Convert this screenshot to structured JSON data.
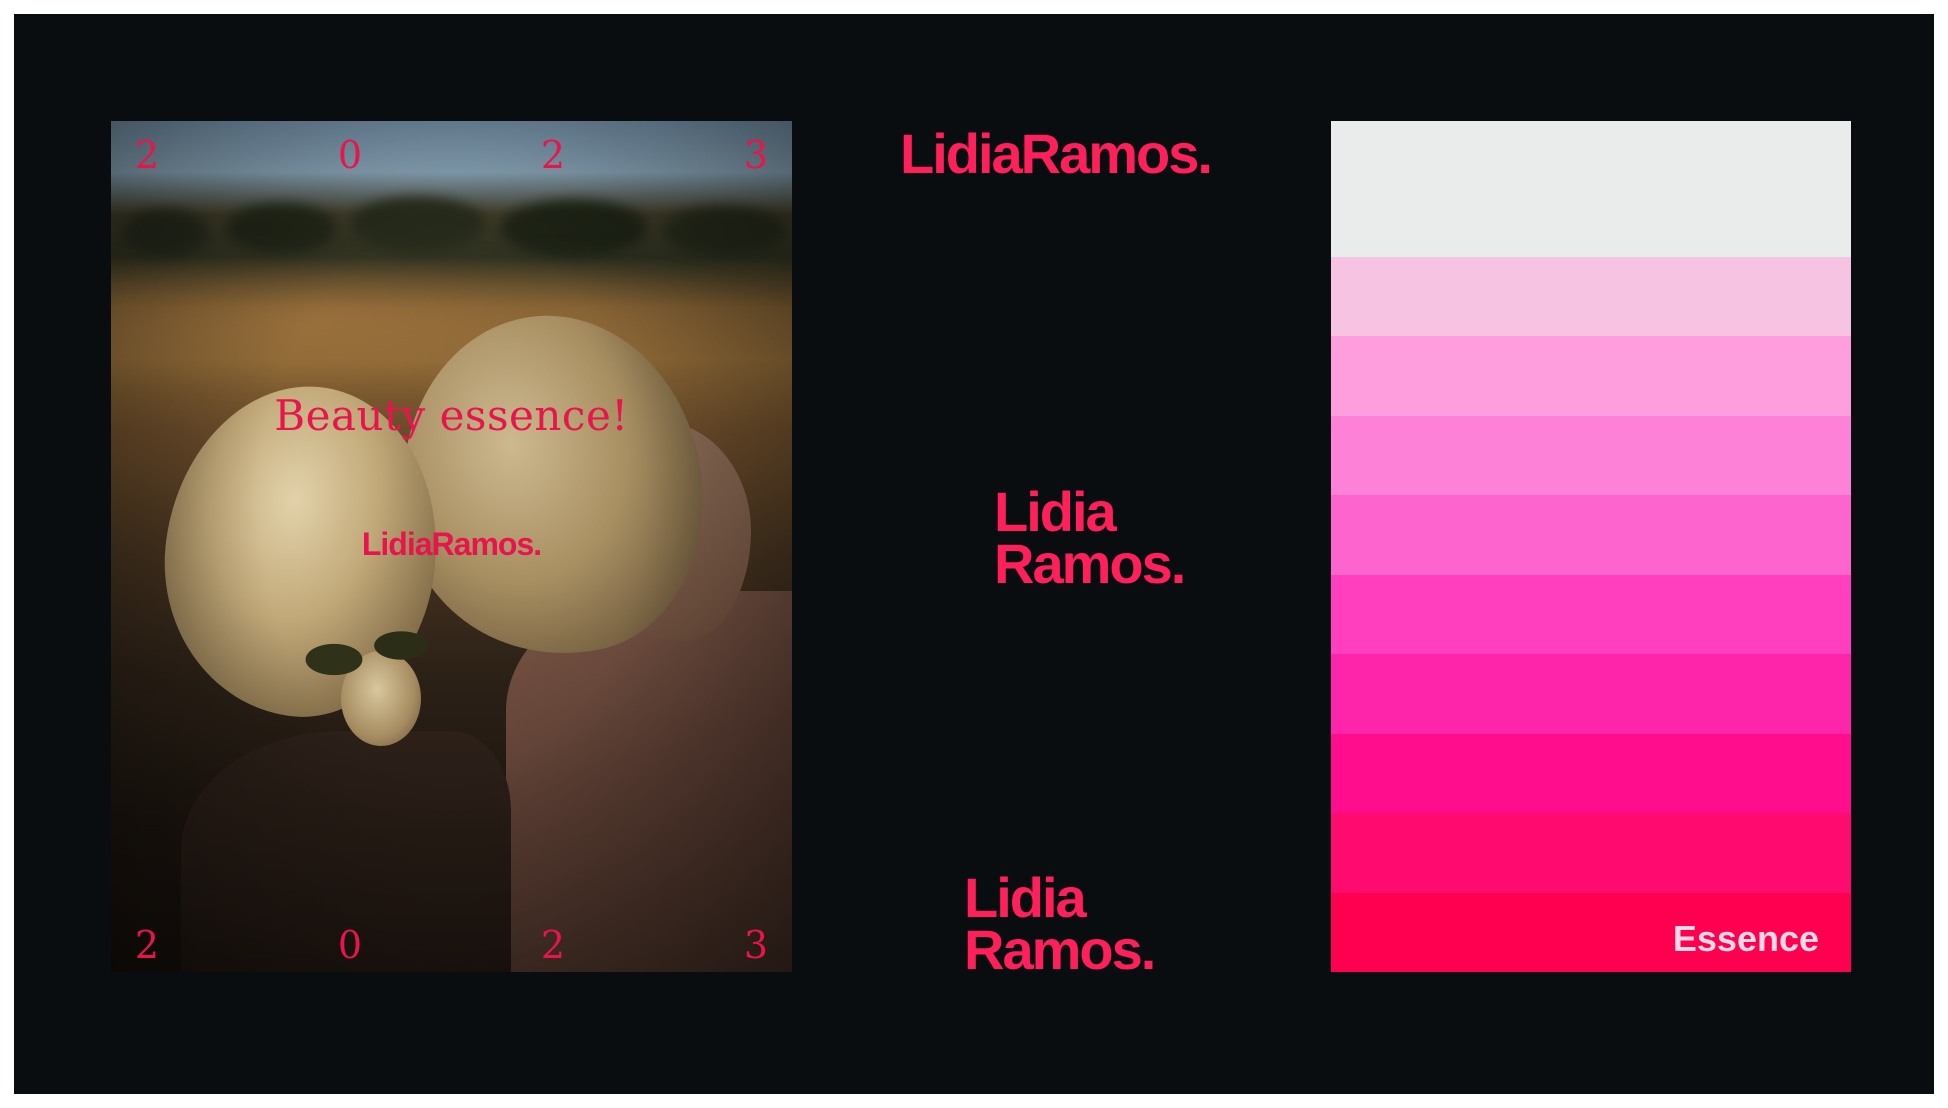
{
  "poster": {
    "year_digits_top": [
      "2",
      "0",
      "2",
      "3"
    ],
    "year_digits_bottom": [
      "2",
      "0",
      "2",
      "3"
    ],
    "tagline": "Beauty essence!",
    "logo": "LidiaRamos."
  },
  "logos": {
    "horizontal": "LidiaRamos.",
    "stacked_primary": {
      "line1": "Lidia",
      "line2": "Ramos."
    },
    "stacked_secondary": {
      "line1": "Lidia",
      "line2": "Ramos."
    }
  },
  "palette": {
    "label": "Essence",
    "colors": [
      "#e9eceb",
      "#f6c3e2",
      "#fe9edd",
      "#fd81d6",
      "#fe64cd",
      "#ff3fbe",
      "#ff25aa",
      "#ff0d8d",
      "#ff0a6e",
      "#fe004f"
    ]
  },
  "colors": {
    "background": "#0a0d10",
    "brand_pink": "#ff1f5a"
  }
}
